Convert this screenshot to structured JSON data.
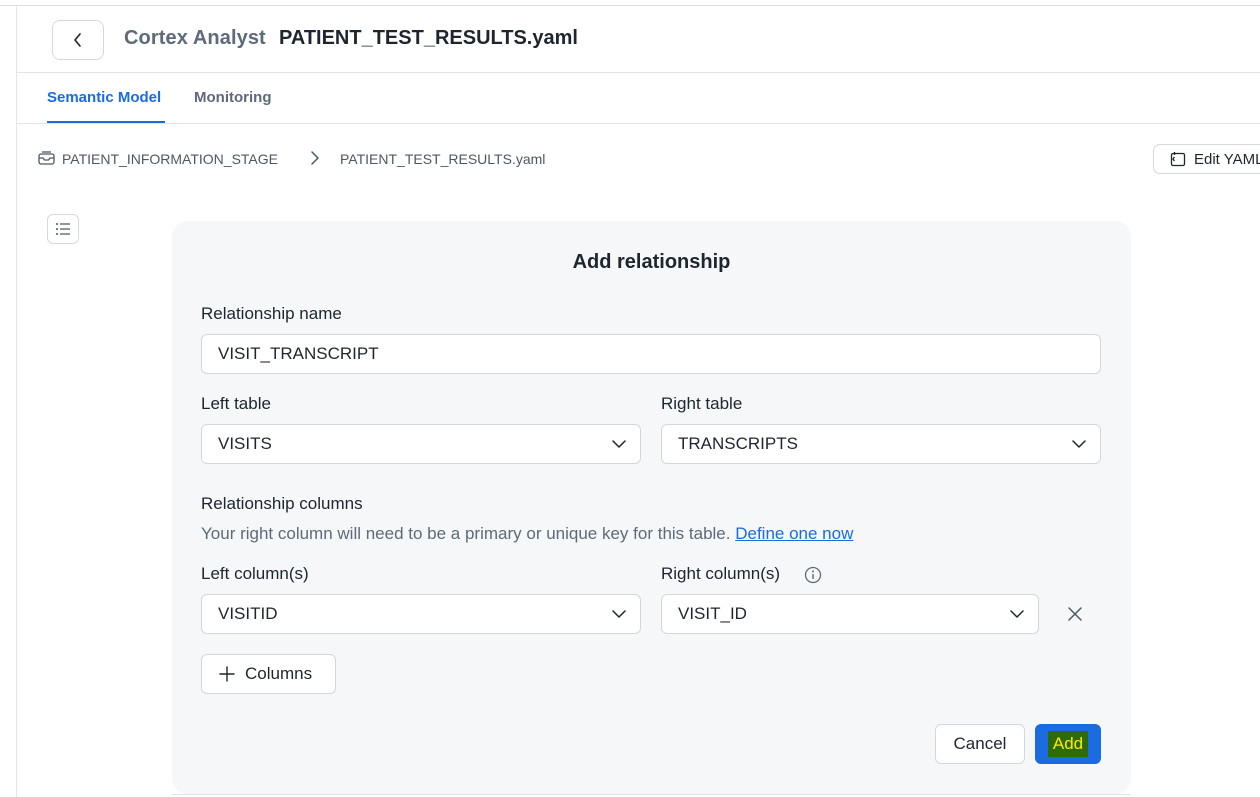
{
  "header": {
    "app_name": "Cortex Analyst",
    "file_name": "PATIENT_TEST_RESULTS.yaml"
  },
  "tabs": [
    {
      "label": "Semantic Model",
      "active": true
    },
    {
      "label": "Monitoring",
      "active": false
    }
  ],
  "breadcrumb": {
    "stage": "PATIENT_INFORMATION_STAGE",
    "file": "PATIENT_TEST_RESULTS.yaml"
  },
  "toolbar": {
    "edit_yaml_label": "Edit YAML"
  },
  "modal": {
    "title": "Add relationship",
    "relationship_name_label": "Relationship name",
    "relationship_name_value": "VISIT_TRANSCRIPT",
    "left_table_label": "Left table",
    "left_table_value": "VISITS",
    "right_table_label": "Right table",
    "right_table_value": "TRANSCRIPTS",
    "relationship_columns_label": "Relationship columns",
    "helper_text": "Your right column will need to be a primary or unique key for this table.",
    "helper_link": "Define one now",
    "left_columns_label": "Left column(s)",
    "left_columns_value": "VISITID",
    "right_columns_label": "Right column(s)",
    "right_columns_value": "VISIT_ID",
    "add_columns_label": "Columns",
    "cancel_label": "Cancel",
    "add_label": "Add"
  },
  "colors": {
    "accent": "#1a6ce0",
    "highlight_bg": "#2e6b07",
    "highlight_text": "#ffeb00"
  },
  "icons": [
    "chevron-left-icon",
    "stage-icon",
    "chevron-right-icon",
    "edit-file-icon",
    "list-icon",
    "chevron-down-icon",
    "info-icon",
    "close-icon",
    "plus-icon"
  ]
}
